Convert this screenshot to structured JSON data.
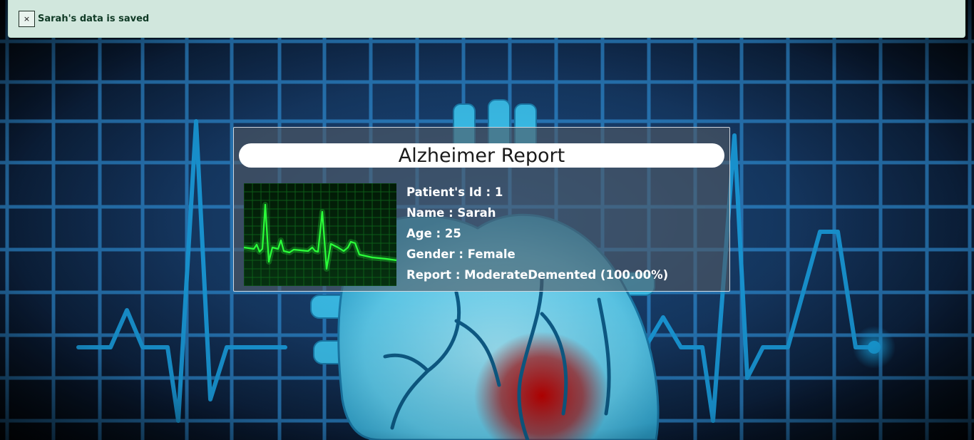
{
  "alert": {
    "close_label": "×",
    "message": "Sarah's data is saved"
  },
  "report": {
    "title": "Alzheimer Report",
    "fields": [
      {
        "label": "Patient's Id",
        "value": "1"
      },
      {
        "label": "Name",
        "value": "Sarah"
      },
      {
        "label": "Age",
        "value": "25"
      },
      {
        "label": "Gender",
        "value": "Female"
      },
      {
        "label": "Report",
        "value": "ModerateDemented (100.00%)"
      }
    ]
  },
  "colors": {
    "alert_background": "#d1e7dd",
    "alert_text": "#0f3a25",
    "ecg_line": "#2bff3a",
    "grid": "#2f8fd8"
  },
  "icons": {
    "close": "close-icon",
    "background": "heart-ecg-background-image",
    "thumbnail": "ecg-monitor-image"
  }
}
